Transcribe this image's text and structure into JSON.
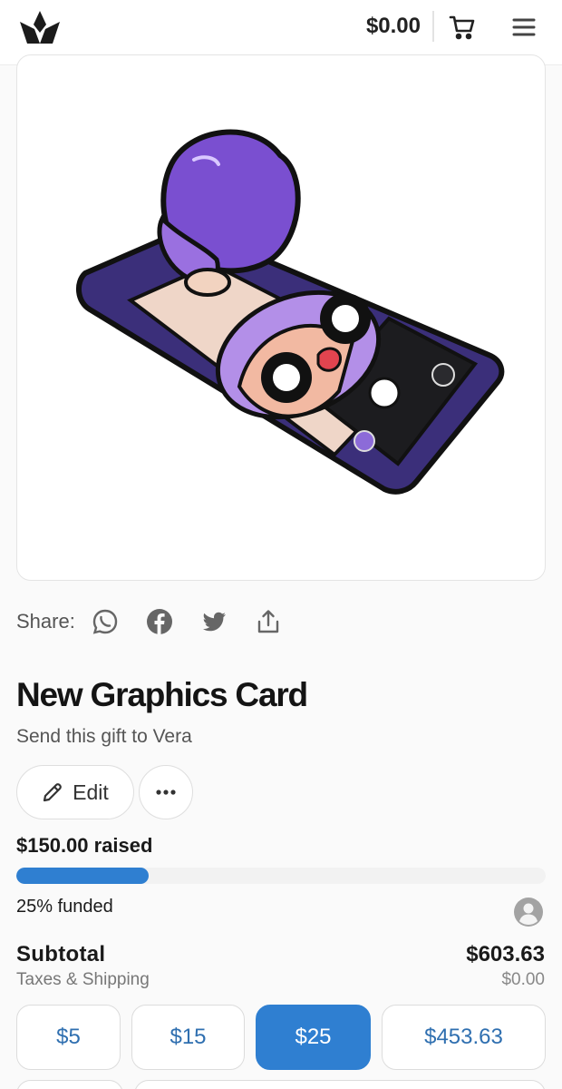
{
  "header": {
    "logo_icon": "crown-logo-icon",
    "balance": "$0.00",
    "cart_icon": "cart-icon",
    "menu_icon": "hamburger-menu-icon"
  },
  "gift_image": {
    "icon": "chibi-phone-selfie-illustration"
  },
  "share": {
    "label": "Share:",
    "icons": [
      "whatsapp-icon",
      "facebook-icon",
      "twitter-icon",
      "share-upload-icon"
    ]
  },
  "gift": {
    "title": "New Graphics Card",
    "subtitle": "Send this gift to Vera",
    "edit_label": "Edit",
    "edit_icon": "pencil-icon",
    "more_icon": "more-dots-icon"
  },
  "funding": {
    "raised": "$150.00 raised",
    "percent": 25,
    "funded": "25% funded",
    "avatar_icon": "user-avatar-icon"
  },
  "summary": {
    "subtotal_label": "Subtotal",
    "subtotal_value": "$603.63",
    "taxes_label": "Taxes & Shipping",
    "taxes_value": "$0.00"
  },
  "amounts": [
    {
      "label": "$5",
      "selected": false
    },
    {
      "label": "$15",
      "selected": false
    },
    {
      "label": "$25",
      "selected": true
    },
    {
      "label": "$453.63",
      "selected": false
    }
  ],
  "colors": {
    "accent": "#2f7fd1",
    "amount_text": "#2f6fb0",
    "hair_purple": "#7a4fd0",
    "phone_body": "#3b2f7a"
  }
}
